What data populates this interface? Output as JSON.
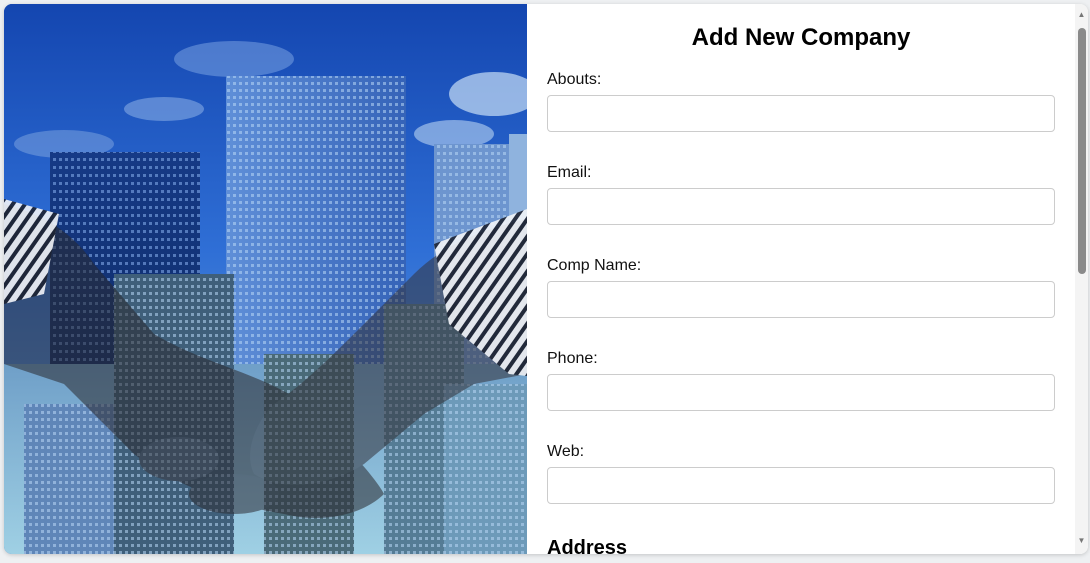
{
  "hero": {
    "image_icon": "handshake-city-photo"
  },
  "form": {
    "title": "Add New Company",
    "fields": [
      {
        "label": "Abouts:",
        "value": "",
        "placeholder": ""
      },
      {
        "label": "Email:",
        "value": "",
        "placeholder": ""
      },
      {
        "label": "Comp Name:",
        "value": "",
        "placeholder": ""
      },
      {
        "label": "Phone:",
        "value": "",
        "placeholder": ""
      },
      {
        "label": "Web:",
        "value": "",
        "placeholder": ""
      }
    ],
    "address_heading": "Address"
  },
  "scrollbar": {
    "up_icon": "scroll-up-icon",
    "down_icon": "scroll-down-icon"
  },
  "colors": {
    "sky": "#1a4fb8",
    "input_border": "#cccccc",
    "scroll_thumb": "#8a8a8a"
  }
}
